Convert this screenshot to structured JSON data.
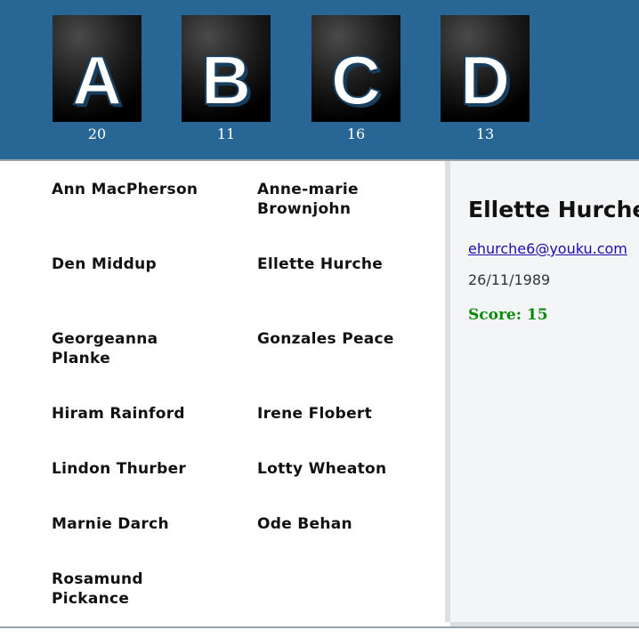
{
  "letter_tiles": [
    {
      "letter": "A",
      "count": "20"
    },
    {
      "letter": "B",
      "count": "11"
    },
    {
      "letter": "C",
      "count": "16"
    },
    {
      "letter": "D",
      "count": "13"
    }
  ],
  "people": [
    "Ann MacPherson",
    "Anne-marie Brownjohn",
    "Den Middup",
    "Ellette Hurche",
    "Georgeanna Planke",
    "Gonzales Peace",
    "Hiram Rainford",
    "Irene Flobert",
    "Lindon Thurber",
    "Lotty Wheaton",
    "Marnie Darch",
    "Ode Behan",
    "Rosamund Pickance"
  ],
  "detail": {
    "name": "Ellette Hurche",
    "email": "ehurche6@youku.com",
    "dob": "26/11/1989",
    "score": "Score: 15"
  },
  "colors": {
    "header_bg": "#286795",
    "score_green": "#0a8a0a",
    "link_blue": "#1a0dab",
    "detail_bg": "#f4f5f7"
  }
}
